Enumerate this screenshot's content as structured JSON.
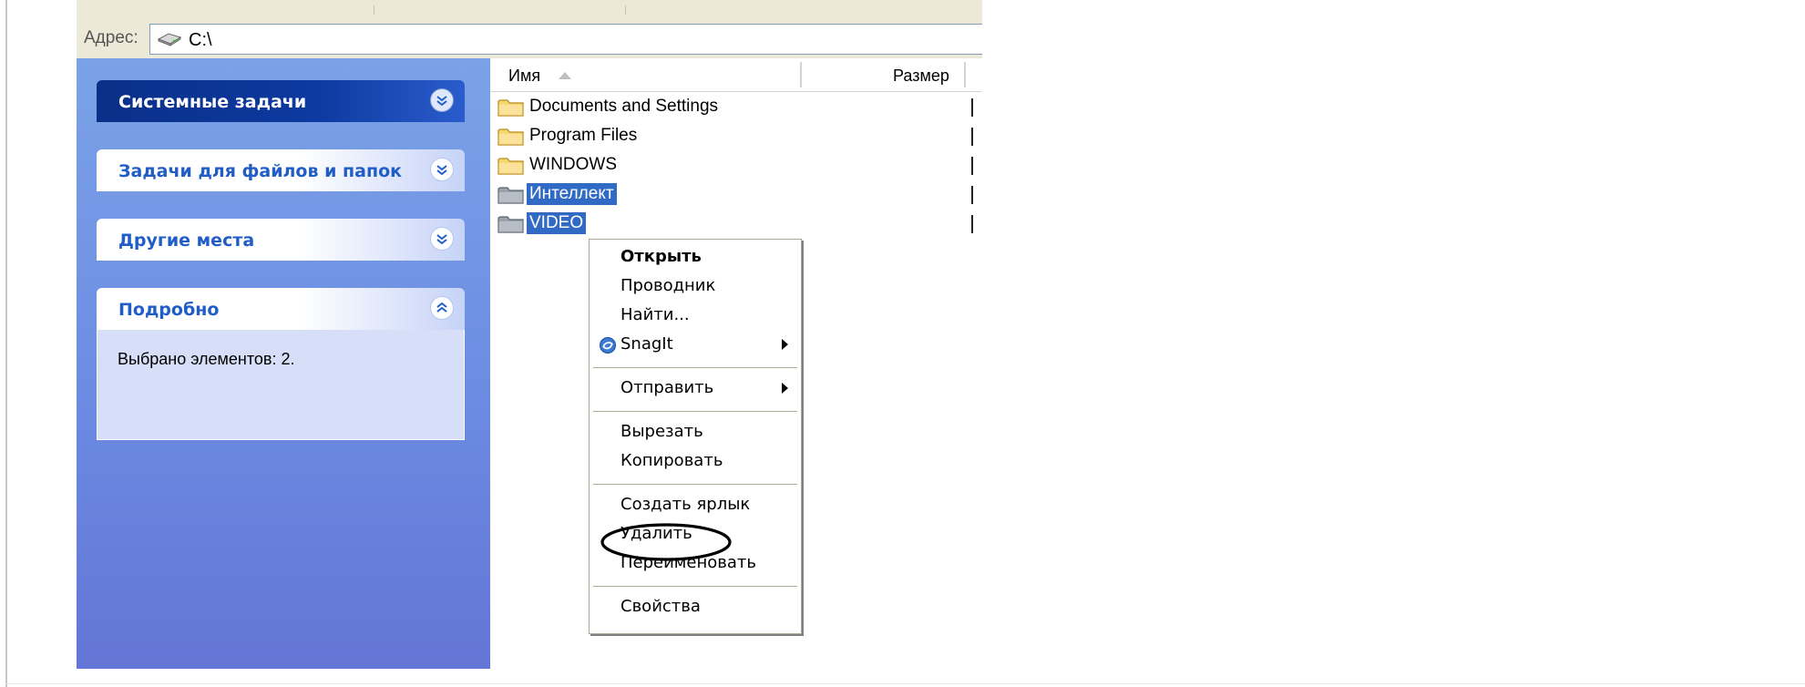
{
  "address": {
    "label": "Адрес:",
    "value": "C:\\",
    "icon": "drive-icon"
  },
  "task_pane": {
    "panels": [
      {
        "title": "Системные задачи",
        "state": "collapsed",
        "style": "dark"
      },
      {
        "title": "Задачи для файлов и папок",
        "state": "collapsed",
        "style": "light"
      },
      {
        "title": "Другие места",
        "state": "collapsed",
        "style": "light"
      },
      {
        "title": "Подробно",
        "state": "expanded",
        "style": "light",
        "body": "Выбрано элементов: 2."
      }
    ]
  },
  "file_list": {
    "columns": [
      {
        "label": "Имя",
        "sort": "ascending"
      },
      {
        "label": "Размер"
      }
    ],
    "rows": [
      {
        "name": "Documents and Settings",
        "icon": "folder-icon",
        "selected": false
      },
      {
        "name": "Program Files",
        "icon": "folder-icon",
        "selected": false
      },
      {
        "name": "WINDOWS",
        "icon": "folder-icon",
        "selected": false
      },
      {
        "name": "Интеллект",
        "icon": "folder-gray-icon",
        "selected": true
      },
      {
        "name": "VIDEO",
        "icon": "folder-gray-icon",
        "selected": true
      }
    ]
  },
  "context_menu": {
    "items": [
      {
        "label": "Открыть",
        "default": true
      },
      {
        "label": "Проводник"
      },
      {
        "label": "Найти..."
      },
      {
        "label": "SnagIt",
        "icon": "snagit-icon",
        "submenu": true
      },
      {
        "label": "Отправить",
        "submenu": true
      },
      {
        "label": "Вырезать"
      },
      {
        "label": "Копировать"
      },
      {
        "label": "Создать ярлык"
      },
      {
        "label": "Удалить",
        "highlighted_by_circle": true
      },
      {
        "label": "Переименовать"
      },
      {
        "label": "Свойства"
      }
    ]
  },
  "colors": {
    "selection": "#316ac5",
    "task_pane_top": "#7ba2e7",
    "task_pane_bottom": "#6375d6",
    "panel_title": "#215dc6"
  }
}
